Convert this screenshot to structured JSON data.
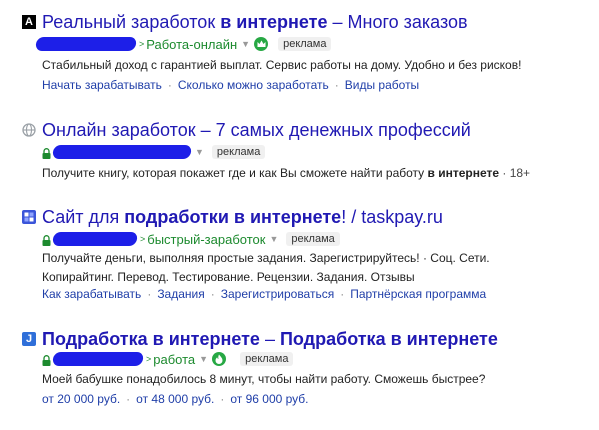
{
  "ads": [
    {
      "favicon": "A",
      "favicon_type": "black-square-letter-icon",
      "title_plain": "Реальный заработок ",
      "title_bold": "в интернете",
      "title_rest": " – Много заказов",
      "path": "Работа-онлайн",
      "ad_label": "реклама",
      "desc_line1": "Стабильный доход с гарантией выплат. Сервис работы на дому. Удобно и без рисков!",
      "links": [
        "Начать зарабатывать",
        "Сколько можно заработать",
        "Виды работы"
      ]
    },
    {
      "favicon_type": "globe-icon",
      "title_plain": "Онлайн заработок – 7 самых денежных профессий",
      "title_bold": "",
      "title_rest": "",
      "path": "",
      "ad_label": "реклама",
      "desc_line1_a": "Получите книгу, которая покажет где и как Вы сможете найти работу ",
      "desc_line1_bold": "в интернете",
      "desc_line1_age": " · 18+",
      "links": []
    },
    {
      "favicon_type": "blue-squares-icon",
      "title_plain": "Сайт для ",
      "title_bold": "подработки в интернете",
      "title_rest": "! / taskpay.ru",
      "path": "быстрый-заработок",
      "ad_label": "реклама",
      "desc_line1": "Получайте деньги, выполняя простые задания. Зарегистрируйтесь! · Соц. Сети.",
      "desc_line2": "Копирайтинг. Перевод. Тестирование. Рецензии. Задания. Отзывы",
      "links": [
        "Как зарабатывать",
        "Задания",
        "Зарегистрироваться",
        "Партнёрская программа"
      ]
    },
    {
      "favicon": "J",
      "favicon_type": "blue-letter-j-icon",
      "title_plain": "",
      "title_bold": "Подработка в интернете",
      "title_rest": " – ",
      "title_bold2": "Подработка в интернете",
      "path": "работа",
      "ad_label": "реклама",
      "desc_line1": "Моей бабушке понадобилось 8 минут, чтобы найти работу. Сможешь быстрее?",
      "links": [
        "от 20 000 руб.",
        "от 48 000 руб.",
        "от 96 000 руб."
      ]
    }
  ],
  "colors": {
    "title": "#2019b3",
    "url_green": "#1c8a2e",
    "redaction": "#1d1fe8",
    "link": "#1f3ea8"
  }
}
